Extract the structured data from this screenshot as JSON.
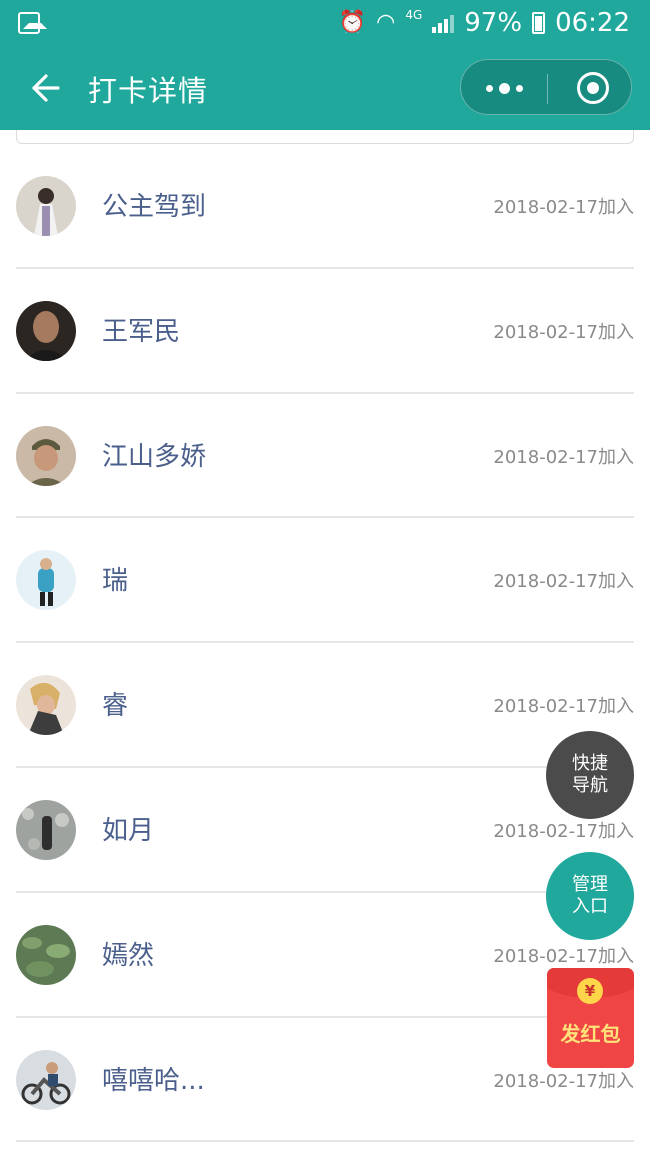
{
  "status_bar": {
    "network": "4G",
    "battery": "97%",
    "time": "06:22"
  },
  "header": {
    "title": "打卡详情",
    "back_icon": "arrow-left-icon",
    "more_icon": "more-dots-icon",
    "close_icon": "target-circle-icon"
  },
  "members": [
    {
      "name": "公主驾到",
      "joined": "2018-02-17加入"
    },
    {
      "name": "王军民",
      "joined": "2018-02-17加入"
    },
    {
      "name": "江山多娇",
      "joined": "2018-02-17加入"
    },
    {
      "name": "瑞",
      "joined": "2018-02-17加入"
    },
    {
      "name": "睿",
      "joined": "2018-02-17加入"
    },
    {
      "name": "如月",
      "joined": "2018-02-17加入"
    },
    {
      "name": "嫣然",
      "joined": "2018-02-17加入"
    },
    {
      "name": "嘻嘻哈...",
      "joined": "2018-02-17加入"
    }
  ],
  "floating": {
    "nav_line1": "快捷",
    "nav_line2": "导航",
    "admin_line1": "管理",
    "admin_line2": "入口",
    "red_packet_coin": "¥",
    "red_packet_label": "发红包"
  },
  "colors": {
    "primary": "#1fa89b",
    "name_text": "#4a5f8c",
    "date_text": "#8a8a8a",
    "red_packet": "#f04545"
  }
}
